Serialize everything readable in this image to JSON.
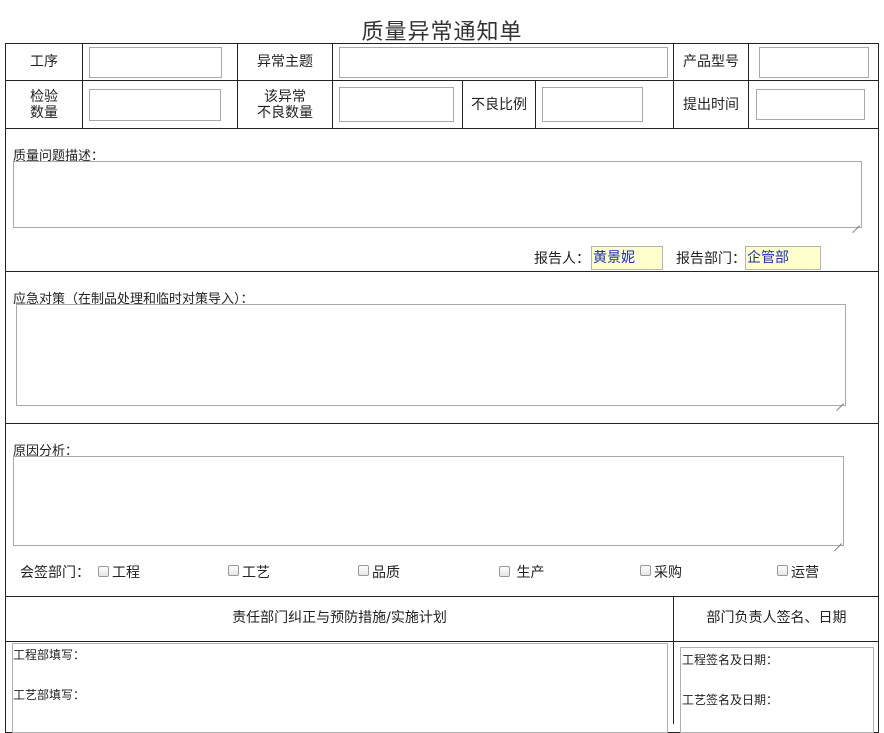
{
  "form": {
    "title": "质量异常通知单",
    "row1": {
      "process_label": "工序",
      "topic_label": "异常主题",
      "model_label": "产品型号"
    },
    "row2": {
      "inspect_label_1": "检验",
      "inspect_label_2": "数量",
      "defect_label_1": "该异常",
      "defect_label_2": "不良数量",
      "ratio_label": "不良比例",
      "time_label": "提出时间"
    },
    "description_label": "质量问题描述：",
    "reporter_label": "报告人：",
    "reporter_value": "黄景妮",
    "dept_label": "报告部门：",
    "dept_value": "企管部",
    "emergency_label": "应急对策（在制品处理和临时对策导入）：",
    "cause_label": "原因分析：",
    "countersign_label": "会签部门：",
    "departments": [
      "工程",
      "工艺",
      "品质",
      " 生产",
      "采购",
      "运营"
    ],
    "plan_header": "责任部门纠正与预防措施/实施计划",
    "sign_header": "部门负责人签名、日期",
    "eng_fill": "工程部填写：",
    "proc_fill": "工艺部填写：",
    "eng_sign": "工程签名及日期：",
    "proc_sign": "工艺签名及日期："
  },
  "colors": {
    "highlight_bg": "#ffffcc",
    "highlight_text": "#1c2fb8",
    "border": "#222222"
  }
}
